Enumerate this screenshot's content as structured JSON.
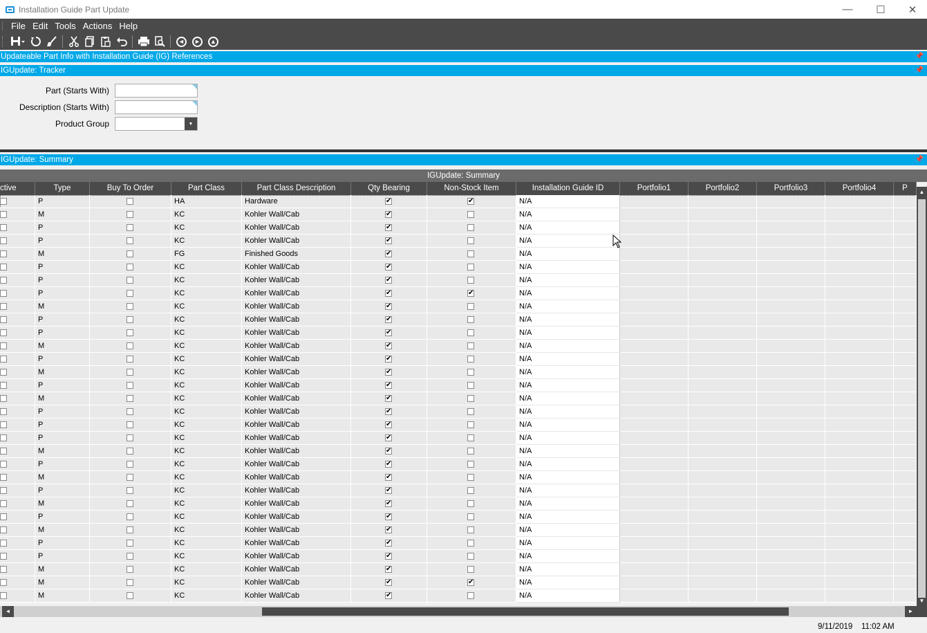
{
  "window": {
    "title": "Installation Guide Part Update",
    "minimize": "—",
    "maximize": "☐",
    "close": "✕"
  },
  "menu": [
    "File",
    "Edit",
    "Tools",
    "Actions",
    "Help"
  ],
  "panels": {
    "info": "Updateable Part Info with Installation Guide (IG) References",
    "tracker": "IGUpdate: Tracker",
    "summary": "IGUpdate: Summary"
  },
  "tracker": {
    "part_label": "Part (Starts With)",
    "part_value": "",
    "description_label": "Description (Starts With)",
    "description_value": "",
    "product_group_label": "Product Group",
    "product_group_value": ""
  },
  "grid": {
    "caption": "IGUpdate: Summary",
    "columns": [
      "ctive",
      "Type",
      "Buy To Order",
      "Part Class",
      "Part Class Description",
      "Qty Bearing",
      "Non-Stock Item",
      "Installation Guide ID",
      "Portfolio1",
      "Portfolio2",
      "Portfolio3",
      "Portfolio4",
      "P"
    ],
    "rows": [
      {
        "type": "P",
        "class": "HA",
        "desc": "Hardware",
        "nonstock": true,
        "igid": "N/A"
      },
      {
        "type": "M",
        "class": "KC",
        "desc": "Kohler Wall/Cab",
        "nonstock": false,
        "igid": "N/A"
      },
      {
        "type": "P",
        "class": "KC",
        "desc": "Kohler Wall/Cab",
        "nonstock": false,
        "igid": "N/A"
      },
      {
        "type": "P",
        "class": "KC",
        "desc": "Kohler Wall/Cab",
        "nonstock": false,
        "igid": "N/A"
      },
      {
        "type": "M",
        "class": "FG",
        "desc": "Finished Goods",
        "nonstock": false,
        "igid": "N/A"
      },
      {
        "type": "P",
        "class": "KC",
        "desc": "Kohler Wall/Cab",
        "nonstock": false,
        "igid": "N/A"
      },
      {
        "type": "P",
        "class": "KC",
        "desc": "Kohler Wall/Cab",
        "nonstock": false,
        "igid": "N/A"
      },
      {
        "type": "P",
        "class": "KC",
        "desc": "Kohler Wall/Cab",
        "nonstock": true,
        "igid": "N/A"
      },
      {
        "type": "M",
        "class": "KC",
        "desc": "Kohler Wall/Cab",
        "nonstock": false,
        "igid": "N/A"
      },
      {
        "type": "P",
        "class": "KC",
        "desc": "Kohler Wall/Cab",
        "nonstock": false,
        "igid": "N/A"
      },
      {
        "type": "P",
        "class": "KC",
        "desc": "Kohler Wall/Cab",
        "nonstock": false,
        "igid": "N/A"
      },
      {
        "type": "M",
        "class": "KC",
        "desc": "Kohler Wall/Cab",
        "nonstock": false,
        "igid": "N/A"
      },
      {
        "type": "P",
        "class": "KC",
        "desc": "Kohler Wall/Cab",
        "nonstock": false,
        "igid": "N/A"
      },
      {
        "type": "M",
        "class": "KC",
        "desc": "Kohler Wall/Cab",
        "nonstock": false,
        "igid": "N/A"
      },
      {
        "type": "P",
        "class": "KC",
        "desc": "Kohler Wall/Cab",
        "nonstock": false,
        "igid": "N/A"
      },
      {
        "type": "M",
        "class": "KC",
        "desc": "Kohler Wall/Cab",
        "nonstock": false,
        "igid": "N/A"
      },
      {
        "type": "P",
        "class": "KC",
        "desc": "Kohler Wall/Cab",
        "nonstock": false,
        "igid": "N/A"
      },
      {
        "type": "P",
        "class": "KC",
        "desc": "Kohler Wall/Cab",
        "nonstock": false,
        "igid": "N/A"
      },
      {
        "type": "P",
        "class": "KC",
        "desc": "Kohler Wall/Cab",
        "nonstock": false,
        "igid": "N/A"
      },
      {
        "type": "M",
        "class": "KC",
        "desc": "Kohler Wall/Cab",
        "nonstock": false,
        "igid": "N/A"
      },
      {
        "type": "P",
        "class": "KC",
        "desc": "Kohler Wall/Cab",
        "nonstock": false,
        "igid": "N/A"
      },
      {
        "type": "M",
        "class": "KC",
        "desc": "Kohler Wall/Cab",
        "nonstock": false,
        "igid": "N/A"
      },
      {
        "type": "P",
        "class": "KC",
        "desc": "Kohler Wall/Cab",
        "nonstock": false,
        "igid": "N/A"
      },
      {
        "type": "M",
        "class": "KC",
        "desc": "Kohler Wall/Cab",
        "nonstock": false,
        "igid": "N/A"
      },
      {
        "type": "P",
        "class": "KC",
        "desc": "Kohler Wall/Cab",
        "nonstock": false,
        "igid": "N/A"
      },
      {
        "type": "M",
        "class": "KC",
        "desc": "Kohler Wall/Cab",
        "nonstock": false,
        "igid": "N/A"
      },
      {
        "type": "P",
        "class": "KC",
        "desc": "Kohler Wall/Cab",
        "nonstock": false,
        "igid": "N/A"
      },
      {
        "type": "P",
        "class": "KC",
        "desc": "Kohler Wall/Cab",
        "nonstock": false,
        "igid": "N/A"
      },
      {
        "type": "M",
        "class": "KC",
        "desc": "Kohler Wall/Cab",
        "nonstock": false,
        "igid": "N/A"
      },
      {
        "type": "M",
        "class": "KC",
        "desc": "Kohler Wall/Cab",
        "nonstock": true,
        "igid": "N/A"
      },
      {
        "type": "M",
        "class": "KC",
        "desc": "Kohler Wall/Cab",
        "nonstock": false,
        "igid": "N/A"
      }
    ]
  },
  "status": {
    "date": "9/11/2019",
    "time": "11:02 AM"
  }
}
